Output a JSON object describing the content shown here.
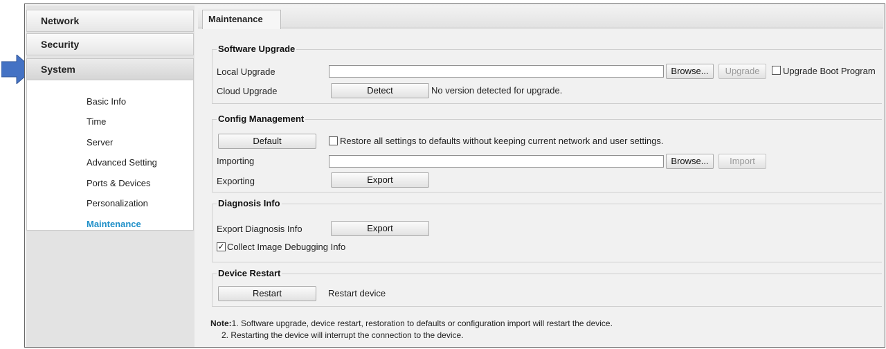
{
  "sidebar": {
    "sections": [
      "Network",
      "Security",
      "System"
    ],
    "items": [
      "Basic Info",
      "Time",
      "Server",
      "Advanced Setting",
      "Ports & Devices",
      "Personalization",
      "Maintenance"
    ],
    "selected": "Maintenance"
  },
  "tab": {
    "label": "Maintenance"
  },
  "software_upgrade": {
    "title": "Software Upgrade",
    "local_upgrade_label": "Local Upgrade",
    "local_upgrade_value": "",
    "browse_label": "Browse...",
    "upgrade_label": "Upgrade",
    "boot_program_label": "Upgrade Boot Program",
    "boot_program_checked": false,
    "cloud_upgrade_label": "Cloud Upgrade",
    "detect_label": "Detect",
    "cloud_status": "No version detected for upgrade."
  },
  "config_management": {
    "title": "Config Management",
    "default_label": "Default",
    "restore_label": "Restore all settings to defaults without keeping current network and user settings.",
    "restore_checked": false,
    "importing_label": "Importing",
    "importing_value": "",
    "browse_label": "Browse...",
    "import_label": "Import",
    "exporting_label": "Exporting",
    "export_label": "Export"
  },
  "diagnosis_info": {
    "title": "Diagnosis Info",
    "export_diag_label": "Export Diagnosis Info",
    "export_label": "Export",
    "collect_label": "Collect Image Debugging Info",
    "collect_checked": true
  },
  "device_restart": {
    "title": "Device Restart",
    "restart_label": "Restart",
    "restart_desc": "Restart device"
  },
  "note": {
    "prefix": "Note:",
    "line1": "1. Software upgrade, device restart, restoration to defaults or configuration import will restart the device.",
    "line2": "2. Restarting the device will interrupt the connection to the device."
  },
  "colors": {
    "accent": "#1e8fc8",
    "arrow": "#4472c4"
  }
}
